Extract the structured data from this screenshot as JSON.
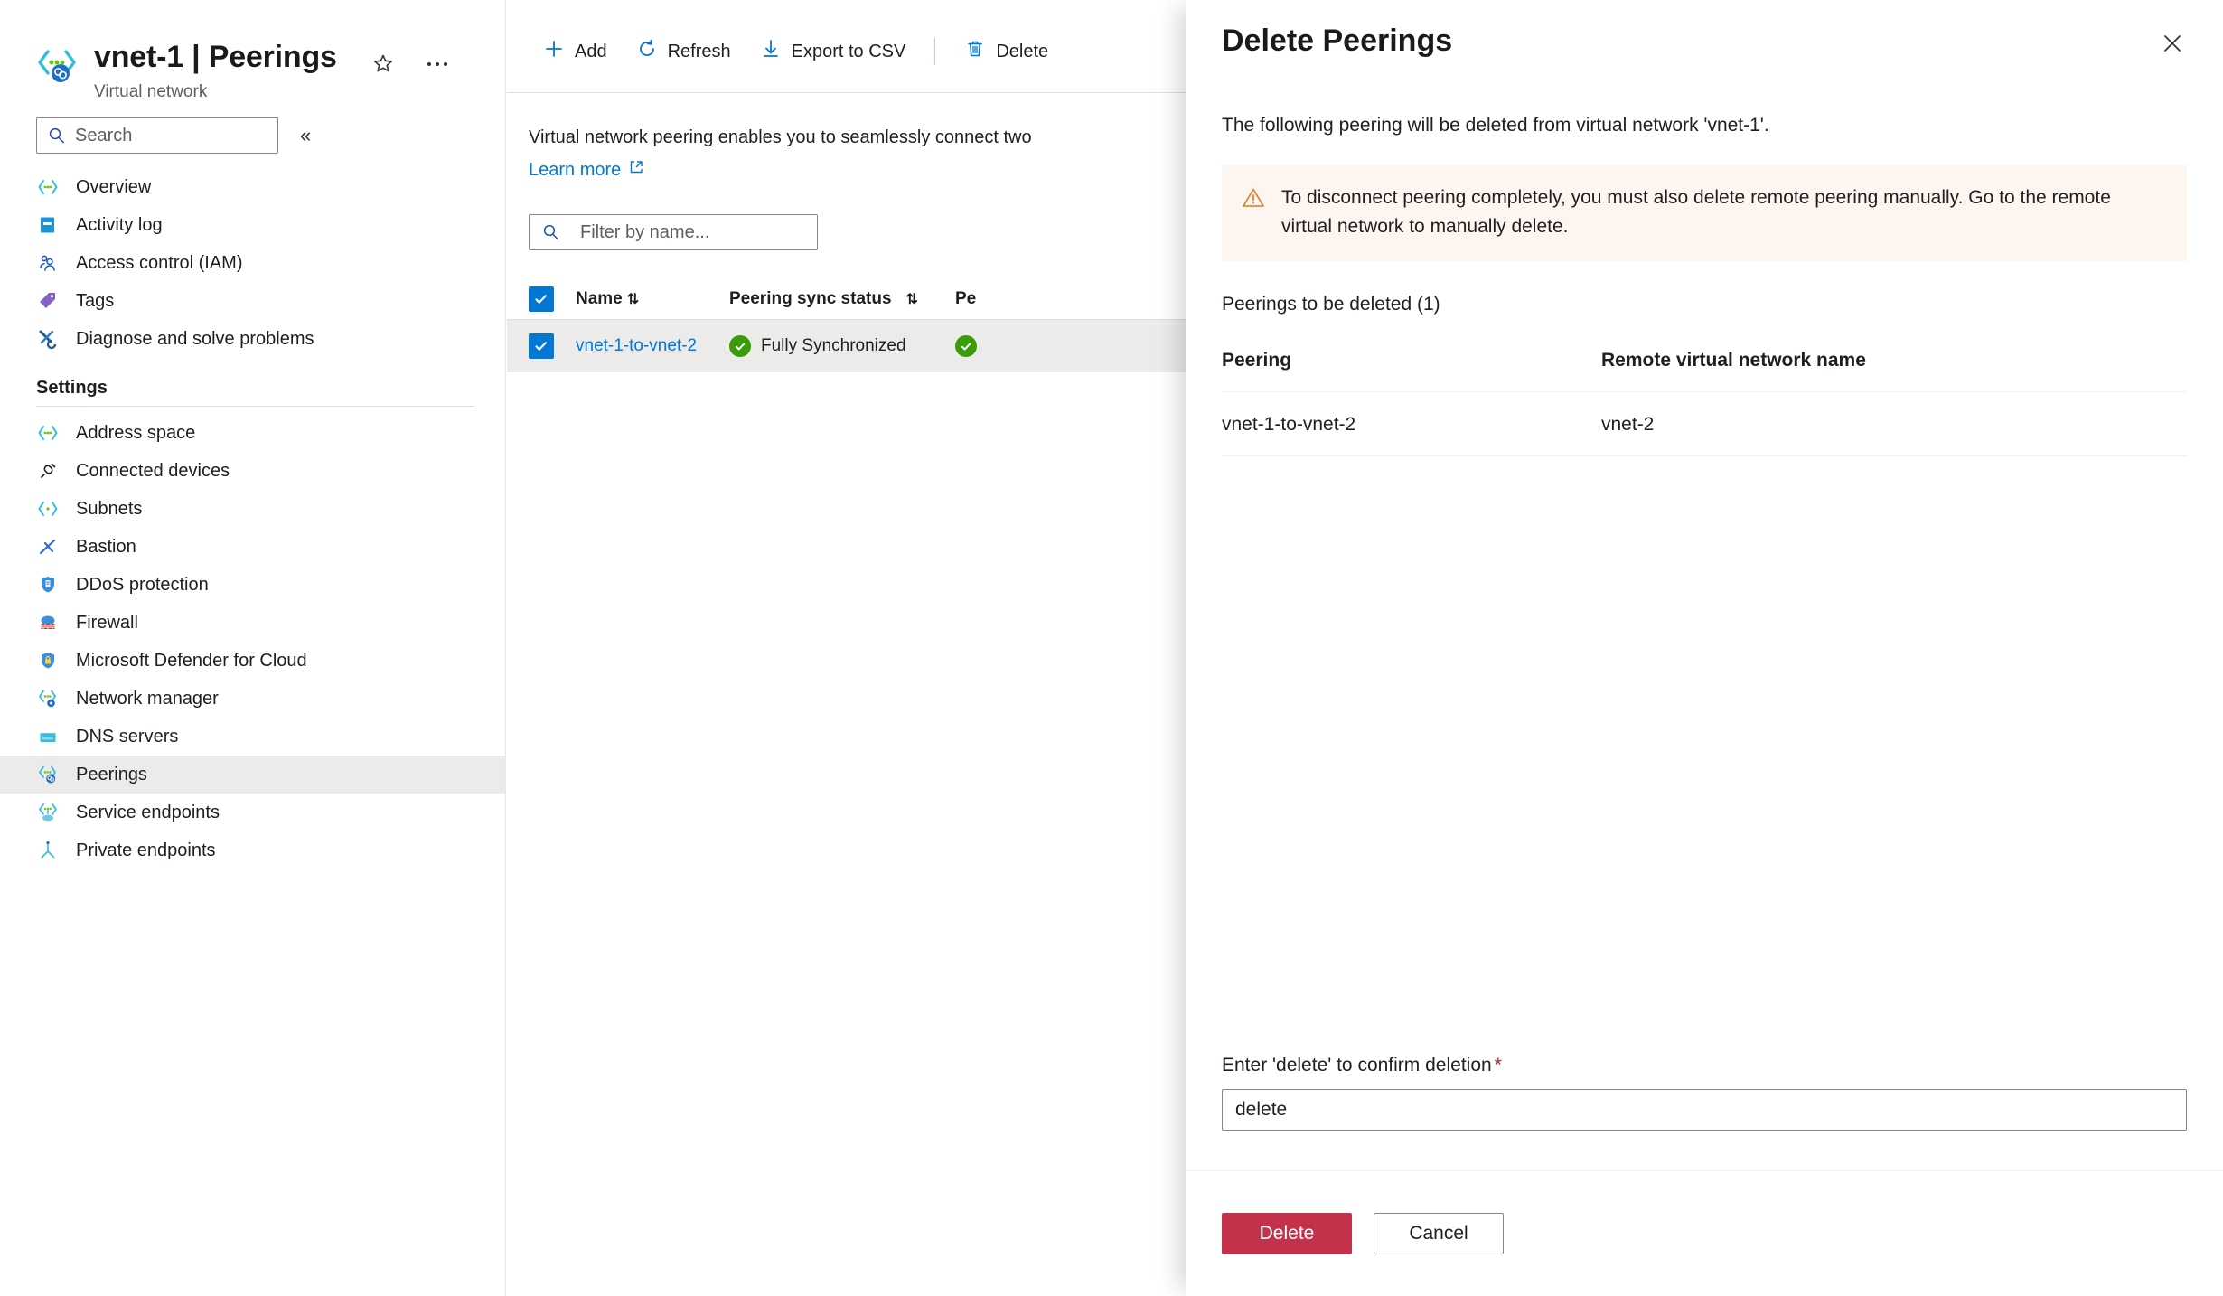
{
  "resource": {
    "title": "vnet-1 | Peerings",
    "subtitle": "Virtual network",
    "icon": "virtual-network-peering-icon",
    "favorite_icon": "star-outline-icon",
    "more_icon": "ellipsis-icon",
    "search": {
      "placeholder": "Search",
      "value": "",
      "icon": "search-icon"
    },
    "collapse_icon": "chevron-double-left-icon"
  },
  "sidebar": {
    "items": [
      {
        "label": "Overview",
        "icon": "overview-icon",
        "selected": false
      },
      {
        "label": "Activity log",
        "icon": "activity-log-icon",
        "selected": false
      },
      {
        "label": "Access control (IAM)",
        "icon": "access-control-icon",
        "selected": false
      },
      {
        "label": "Tags",
        "icon": "tags-icon",
        "selected": false
      },
      {
        "label": "Diagnose and solve problems",
        "icon": "diagnose-icon",
        "selected": false
      }
    ],
    "group_label": "Settings",
    "settings_items": [
      {
        "label": "Address space",
        "icon": "address-space-icon",
        "selected": false
      },
      {
        "label": "Connected devices",
        "icon": "connected-devices-icon",
        "selected": false
      },
      {
        "label": "Subnets",
        "icon": "subnets-icon",
        "selected": false
      },
      {
        "label": "Bastion",
        "icon": "bastion-icon",
        "selected": false
      },
      {
        "label": "DDoS protection",
        "icon": "ddos-protection-icon",
        "selected": false
      },
      {
        "label": "Firewall",
        "icon": "firewall-icon",
        "selected": false
      },
      {
        "label": "Microsoft Defender for Cloud",
        "icon": "defender-icon",
        "selected": false
      },
      {
        "label": "Network manager",
        "icon": "network-manager-icon",
        "selected": false
      },
      {
        "label": "DNS servers",
        "icon": "dns-servers-icon",
        "selected": false
      },
      {
        "label": "Peerings",
        "icon": "peerings-icon",
        "selected": true
      },
      {
        "label": "Service endpoints",
        "icon": "service-endpoints-icon",
        "selected": false
      },
      {
        "label": "Private endpoints",
        "icon": "private-endpoints-icon",
        "selected": false
      }
    ]
  },
  "toolbar": {
    "add_label": "Add",
    "add_icon": "plus-icon",
    "refresh_label": "Refresh",
    "refresh_icon": "refresh-icon",
    "export_label": "Export to CSV",
    "export_icon": "download-icon",
    "delete_label": "Delete",
    "delete_icon": "trash-icon"
  },
  "main": {
    "blurb": "Virtual network peering enables you to seamlessly connect two",
    "learn_more": "Learn more",
    "learn_more_icon": "external-link-icon",
    "filter": {
      "placeholder": "Filter by name...",
      "value": "",
      "icon": "search-icon"
    },
    "grid": {
      "columns": [
        {
          "label": "Name",
          "sort_icon": "sort-icon"
        },
        {
          "label": "Peering sync status",
          "sort_icon": "sort-icon"
        },
        {
          "label": "Pe",
          "sort_icon": ""
        }
      ],
      "header_checkbox_checked": true,
      "rows": [
        {
          "checked": true,
          "name": "vnet-1-to-vnet-2",
          "sync_status": "Fully Synchronized",
          "sync_status_icon": "check-circle-icon",
          "peering_status_icon": "check-circle-icon"
        }
      ]
    }
  },
  "panel": {
    "title": "Delete Peerings",
    "close_icon": "close-icon",
    "intro": "The following peering will be deleted from virtual network 'vnet-1'.",
    "warning": {
      "icon": "warning-triangle-icon",
      "text": "To disconnect peering completely, you must also delete remote peering manually. Go to the remote virtual network to manually delete."
    },
    "table_caption": "Peerings to be deleted (1)",
    "table": {
      "columns": [
        "Peering",
        "Remote virtual network name"
      ],
      "rows": [
        {
          "peering": "vnet-1-to-vnet-2",
          "remote": "vnet-2"
        }
      ]
    },
    "confirm_label": "Enter 'delete' to confirm deletion",
    "required_marker": "*",
    "confirm_value": "delete",
    "delete_button": "Delete",
    "cancel_button": "Cancel"
  },
  "colors": {
    "accent_blue": "#0078d4",
    "danger_red": "#c4314b",
    "success_green": "#3a9b0b",
    "warning_bg": "#fdf6f0",
    "warning_orange": "#d77b28",
    "selected_row": "#edebe9",
    "required_red": "#a4262c"
  }
}
